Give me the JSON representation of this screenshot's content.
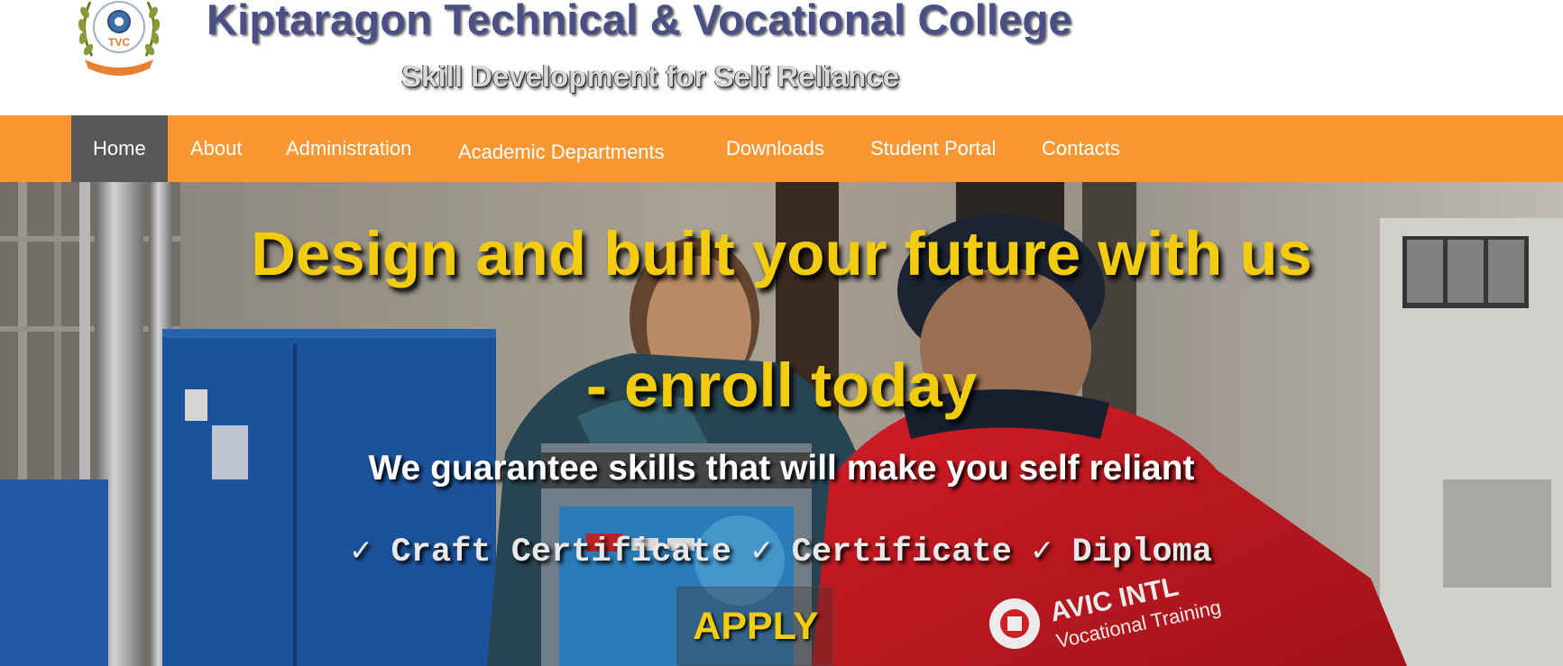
{
  "header": {
    "site_title": "Kiptaragon Technical & Vocational College",
    "tagline": "Skill Development for Self Reliance",
    "logo_text": "TVC",
    "logo_icon": "college-crest-icon"
  },
  "nav": {
    "items": [
      {
        "label": "Home",
        "active": true
      },
      {
        "label": "About"
      },
      {
        "label": "Administration"
      },
      {
        "label": "Academic Departments"
      },
      {
        "label": "Downloads"
      },
      {
        "label": "Student Portal"
      },
      {
        "label": "Contacts"
      }
    ]
  },
  "hero": {
    "title_line1": "Design and built your future with us",
    "title_line2": "- enroll today",
    "subtitle": "We guarantee skills that will make you self reliant",
    "certificates": "✓ Craft Certificate ✓ Certificate ✓ Diploma",
    "apply_label": "APPLY",
    "photo_jacket_brand": "AVIC INTL",
    "photo_jacket_sub": "Vocational Training"
  },
  "colors": {
    "nav_bg": "#fb9733",
    "nav_active_bg": "#575757",
    "title_color": "#4a4f86",
    "hero_accent": "#f4cc0e"
  }
}
